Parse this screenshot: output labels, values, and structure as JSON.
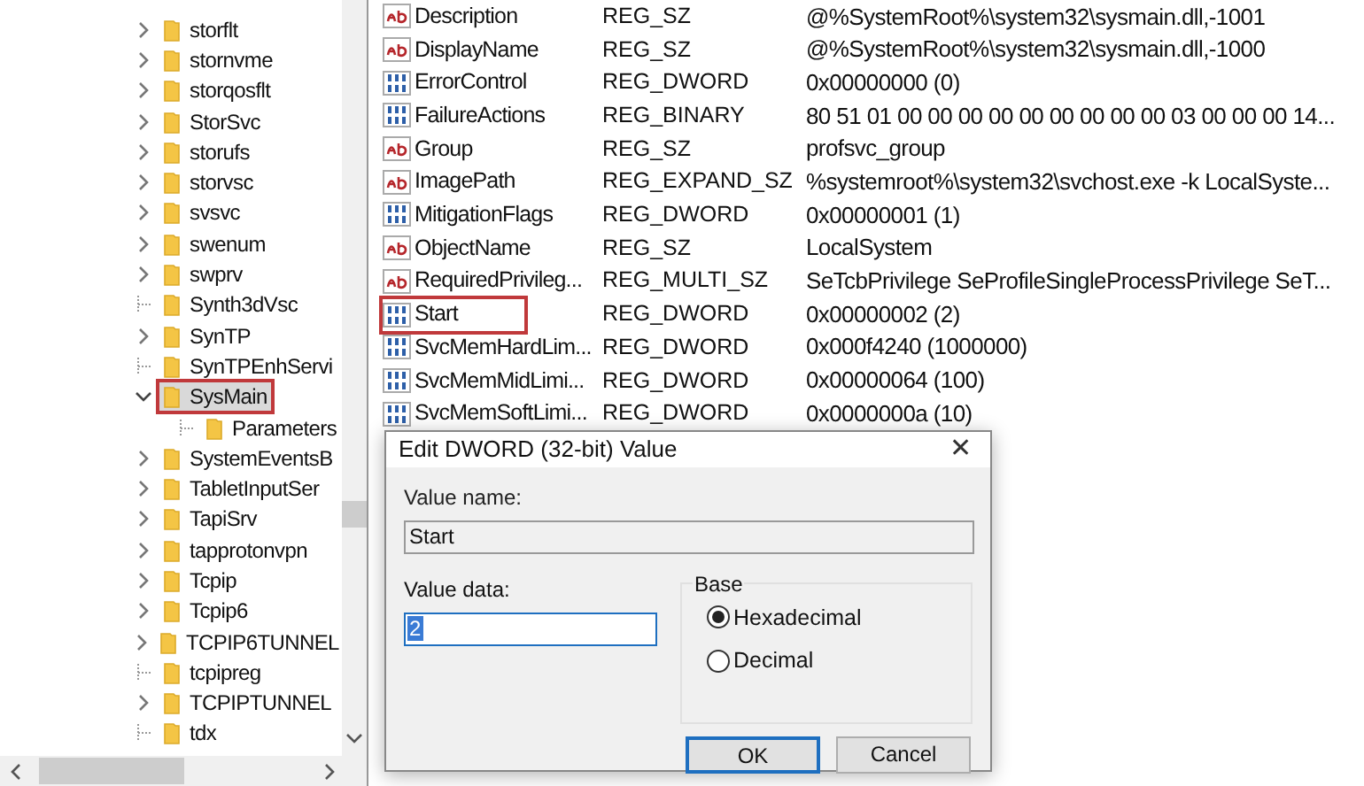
{
  "tree": {
    "items": [
      {
        "label": "storflt",
        "kind": "collapsed",
        "selected": false
      },
      {
        "label": "stornvme",
        "kind": "collapsed",
        "selected": false
      },
      {
        "label": "storqosflt",
        "kind": "collapsed",
        "selected": false
      },
      {
        "label": "StorSvc",
        "kind": "collapsed",
        "selected": false
      },
      {
        "label": "storufs",
        "kind": "collapsed",
        "selected": false
      },
      {
        "label": "storvsc",
        "kind": "collapsed",
        "selected": false
      },
      {
        "label": "svsvc",
        "kind": "collapsed",
        "selected": false
      },
      {
        "label": "swenum",
        "kind": "collapsed",
        "selected": false
      },
      {
        "label": "swprv",
        "kind": "collapsed",
        "selected": false
      },
      {
        "label": "Synth3dVsc",
        "kind": "leaf",
        "selected": false
      },
      {
        "label": "SynTP",
        "kind": "collapsed",
        "selected": false
      },
      {
        "label": "SynTPEnhServi",
        "kind": "leaf",
        "selected": false
      },
      {
        "label": "SysMain",
        "kind": "expanded",
        "selected": true,
        "children": [
          {
            "label": "Parameters",
            "kind": "leaf",
            "selected": false
          }
        ]
      },
      {
        "label": "SystemEventsB",
        "kind": "collapsed",
        "selected": false
      },
      {
        "label": "TabletInputSer",
        "kind": "collapsed",
        "selected": false
      },
      {
        "label": "TapiSrv",
        "kind": "collapsed",
        "selected": false
      },
      {
        "label": "tapprotonvpn",
        "kind": "collapsed",
        "selected": false
      },
      {
        "label": "Tcpip",
        "kind": "collapsed",
        "selected": false
      },
      {
        "label": "Tcpip6",
        "kind": "collapsed",
        "selected": false
      },
      {
        "label": "TCPIP6TUNNEL",
        "kind": "collapsed",
        "selected": false
      },
      {
        "label": "tcpipreg",
        "kind": "leaf",
        "selected": false
      },
      {
        "label": "TCPIPTUNNEL",
        "kind": "collapsed",
        "selected": false
      },
      {
        "label": "tdx",
        "kind": "leaf",
        "selected": false
      }
    ]
  },
  "values": [
    {
      "name": "Description",
      "type": "REG_SZ",
      "data": "@%SystemRoot%\\system32\\sysmain.dll,-1001",
      "kind": "string",
      "outlined": false
    },
    {
      "name": "DisplayName",
      "type": "REG_SZ",
      "data": "@%SystemRoot%\\system32\\sysmain.dll,-1000",
      "kind": "string",
      "outlined": false
    },
    {
      "name": "ErrorControl",
      "type": "REG_DWORD",
      "data": "0x00000000 (0)",
      "kind": "binary",
      "outlined": false
    },
    {
      "name": "FailureActions",
      "type": "REG_BINARY",
      "data": "80 51 01 00 00 00 00 00 00 00 00 00 03 00 00 00 14...",
      "kind": "binary",
      "outlined": false
    },
    {
      "name": "Group",
      "type": "REG_SZ",
      "data": "profsvc_group",
      "kind": "string",
      "outlined": false
    },
    {
      "name": "ImagePath",
      "type": "REG_EXPAND_SZ",
      "data": "%systemroot%\\system32\\svchost.exe -k LocalSyste...",
      "kind": "string",
      "outlined": false
    },
    {
      "name": "MitigationFlags",
      "type": "REG_DWORD",
      "data": "0x00000001 (1)",
      "kind": "binary",
      "outlined": false
    },
    {
      "name": "ObjectName",
      "type": "REG_SZ",
      "data": "LocalSystem",
      "kind": "string",
      "outlined": false
    },
    {
      "name": "RequiredPrivileg...",
      "type": "REG_MULTI_SZ",
      "data": "SeTcbPrivilege SeProfileSingleProcessPrivilege SeT...",
      "kind": "string",
      "outlined": false
    },
    {
      "name": "Start",
      "type": "REG_DWORD",
      "data": "0x00000002 (2)",
      "kind": "binary",
      "outlined": true
    },
    {
      "name": "SvcMemHardLim...",
      "type": "REG_DWORD",
      "data": "0x000f4240 (1000000)",
      "kind": "binary",
      "outlined": false
    },
    {
      "name": "SvcMemMidLimi...",
      "type": "REG_DWORD",
      "data": "0x00000064 (100)",
      "kind": "binary",
      "outlined": false
    },
    {
      "name": "SvcMemSoftLimi...",
      "type": "REG_DWORD",
      "data": "0x0000000a (10)",
      "kind": "binary",
      "outlined": false
    }
  ],
  "dialog": {
    "title": "Edit DWORD (32-bit) Value",
    "close": "✕",
    "value_name_label": "Value name:",
    "value_name": "Start",
    "value_data_label": "Value data:",
    "value_data": "2",
    "base_label": "Base",
    "base_options": [
      {
        "label": "Hexadecimal",
        "selected": true
      },
      {
        "label": "Decimal",
        "selected": false
      }
    ],
    "buttons": [
      {
        "label": "OK",
        "kind": "default"
      },
      {
        "label": "Cancel",
        "kind": "normal"
      }
    ]
  }
}
